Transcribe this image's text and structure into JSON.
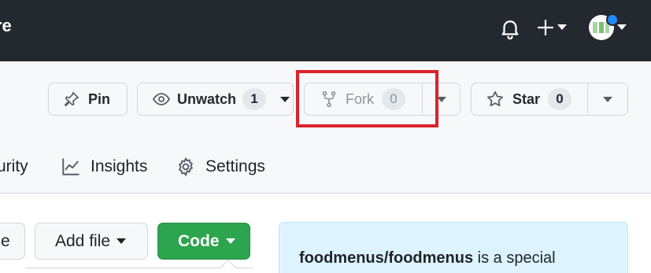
{
  "topbar": {
    "cut_text": "re",
    "icons": [
      "bell-icon",
      "plus-icon",
      "chevron-down-icon",
      "avatar"
    ]
  },
  "repo_actions": {
    "pin_label": "Pin",
    "unwatch_label": "Unwatch",
    "unwatch_count": "1",
    "fork_label": "Fork",
    "fork_count": "0",
    "star_label": "Star",
    "star_count": "0"
  },
  "tabs": {
    "security_partial": "urity",
    "insights": "Insights",
    "settings": "Settings"
  },
  "file_actions": {
    "cut_button": "e",
    "add_file_label": "Add file",
    "code_label": "Code"
  },
  "info_box": {
    "repo_name": "foodmenus/foodmenus",
    "text": " is a special"
  },
  "colors": {
    "topbar": "#24292f",
    "code_button": "#2da44e",
    "highlight": "#d9232a",
    "info_box_bg": "#ddf4ff",
    "notification_dot": "#218bff"
  }
}
